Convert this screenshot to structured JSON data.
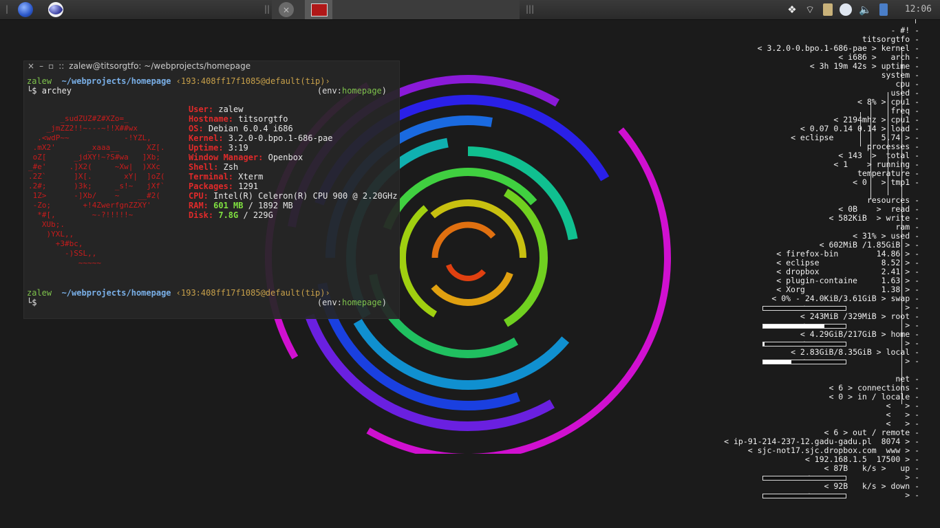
{
  "panel": {
    "launchers": [
      "firefox-icon",
      "eclipse-icon"
    ],
    "tray_icons": [
      "dropbox-icon",
      "wifi-icon",
      "clipboard-icon",
      "network-icon",
      "volume-icon",
      "battery-icon"
    ],
    "clock": "12:06"
  },
  "terminal": {
    "title": "zalew@titsorgtfo: ~/webprojects/homepage",
    "prompt_user": "zalew",
    "prompt_path": "~/webprojects/homepage",
    "prompt_vcs": "‹193:408ff17f1085@default(tip)›",
    "prompt_symbol": "└$",
    "command": "archey",
    "env_prefix": "(env:",
    "env_name": "homepage",
    "env_suffix": ")",
    "logo": "       _sudZUZ#Z#XZo=_\n    _jmZZ2!!~---~!!X##wx\n  .<wdP~~            -!YZL,\n .mX2'       _xaaa__      XZ[.\n oZ[      _jdXY!~?S#wa   ]Xb;\n_#e'     .]X2(     ~Xw|  )XXc\n.2Z`      ]X[.       xY|  ]oZ(\n.2#;      )3k;     _s!~   jXf`\n 1Z>      -]Xb/    ~    __#2(\n -Zo;       +!4ZwerfgnZZXY'\n  *#[,        ~-?!!!!!~\n   XUb;.\n    )YXL,,\n      +3#bc,\n        -)SSL,,\n           ~~~~~",
    "info": [
      {
        "label": "User:",
        "value": "zalew"
      },
      {
        "label": "Hostname:",
        "value": "titsorgtfo"
      },
      {
        "label": "OS:",
        "value": "Debian 6.0.4 i686"
      },
      {
        "label": "Kernel:",
        "value": "3.2.0-0.bpo.1-686-pae"
      },
      {
        "label": "Uptime:",
        "value": "3:19"
      },
      {
        "label": "Window Manager:",
        "value": "Openbox"
      },
      {
        "label": "Shell:",
        "value": "Zsh"
      },
      {
        "label": "Terminal:",
        "value": "Xterm"
      },
      {
        "label": "Packages:",
        "value": "1291"
      },
      {
        "label": "CPU:",
        "value": "Intel(R) Celeron(R) CPU 900 @ 2.20GHz"
      }
    ],
    "ram_label": "RAM:",
    "ram_used": "601 MB",
    "ram_total": " / 1892 MB",
    "disk_label": "Disk:",
    "disk_used": "7.8G",
    "disk_total": " / 229G"
  },
  "conky": {
    "lines": [
      "- #! -",
      "titsorgtfo -",
      "< 3.2.0-0.bpo.1-686-pae > kernel -",
      "< i686 >   arch -",
      "< 3h 19m 42s > uptime -",
      "system -",
      "cpu -",
      "used -",
      "< 8% > cpu1 -",
      "freq -",
      "< 2194mhz > cpu1 -",
      "< 0.07 0.14 0.14 > load -",
      "< eclipse          5.74 > -",
      "processes -",
      "< 143  >  total -",
      "< 1    > running -",
      "temperature -",
      "< 0   > tmp1 -",
      "",
      "resources -",
      "< 0B    >  read -",
      "< 582KiB  > write -",
      "ram -",
      "< 31% > used -",
      "< 602MiB /1.85GiB > -",
      "< firefox-bin        14.86 > -",
      "< eclipse             8.52 > -",
      "< dropbox             2.41 > -",
      "< plugin-containe     1.63 > -",
      "< Xorg                1.38 > -",
      "< 0% - 24.0KiB/3.61GiB > swap -",
      "<                     > -",
      "< 243MiB /329MiB > root -",
      "<                     > -",
      "< 4.29GiB/217GiB > home -",
      "<                     > -",
      "< 2.83GiB/8.35GiB > local -",
      "<                     > -",
      "",
      "net -",
      "< 6 > connections -",
      "< 0 > in / locale -",
      "<   > -",
      "<   > -",
      "<   > -",
      "< 6 > out / remote -",
      "< ip-91-214-237-12.gadu-gadu.pl  8074 > -",
      "< sjc-not17.sjc.dropbox.com  www > -",
      "< 192.168.1.5  17500 > -",
      "< 87B   k/s >   up -",
      "<                    > -",
      "< 92B   k/s > down -",
      "<                    > -"
    ],
    "bars": [
      {
        "name": "swap-bar",
        "fill": 0.0
      },
      {
        "name": "root-bar",
        "fill": 0.74
      },
      {
        "name": "home-bar",
        "fill": 0.02
      },
      {
        "name": "local-bar",
        "fill": 0.34
      },
      {
        "name": "up-graph",
        "fill": 0.0
      },
      {
        "name": "down-graph",
        "fill": 0.0
      }
    ]
  }
}
